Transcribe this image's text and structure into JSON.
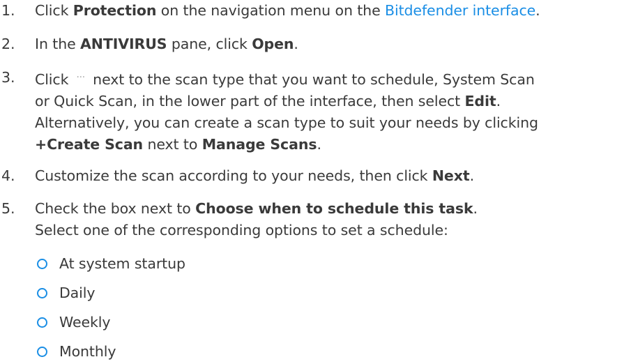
{
  "steps": [
    {
      "num": "1.",
      "t1": "Click ",
      "b1": "Protection",
      "t2": " on the navigation menu on the ",
      "link": "Bitdefender interface",
      "t3": "."
    },
    {
      "num": "2.",
      "t1": "In the ",
      "b1": "ANTIVIRUS",
      "t2": " pane, click ",
      "b2": "Open",
      "t3": "."
    },
    {
      "num": "3.",
      "l1a": "Click ",
      "dots": "···",
      "l1b": " next to the scan type that you want to schedule, System Scan",
      "l2a": "or Quick Scan, in the lower part of the interface, then select ",
      "l2b": "Edit",
      "l2c": ".",
      "l3": "Alternatively, you can create a scan type to suit your needs by clicking",
      "l4b1": "+Create Scan",
      "l4a": " next to ",
      "l4b2": "Manage Scans",
      "l4c": "."
    },
    {
      "num": "4.",
      "t1": "Customize the scan according to your needs, then click ",
      "b1": "Next",
      "t2": "."
    },
    {
      "num": "5.",
      "l1a": "Check the box next to ",
      "l1b": "Choose when to schedule this task",
      "l1c": ".",
      "l2": "Select one of the corresponding options to set a schedule:"
    }
  ],
  "options": [
    "At system startup",
    "Daily",
    "Weekly",
    "Monthly"
  ],
  "colors": {
    "text": "#3a3a3a",
    "link": "#1a8ee5",
    "radio": "#1a8ee5"
  }
}
